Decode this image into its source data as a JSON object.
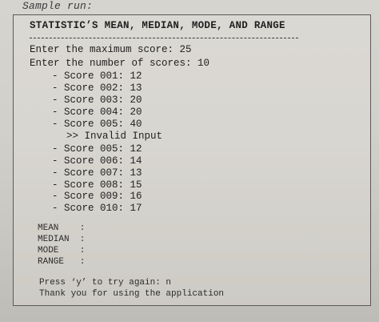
{
  "caption": "Sample run:",
  "heading": "STATISTIC’S MEAN, MEDIAN, MODE, AND RANGE",
  "prompts": [
    "Enter the maximum score: 25",
    "Enter the number of scores: 10"
  ],
  "scores_before_error": [
    "- Score 001: 12",
    "- Score 002: 13",
    "- Score 003: 20",
    "- Score 004: 20",
    "- Score 005: 40"
  ],
  "error": ">> Invalid Input",
  "scores_after_error": [
    "- Score 005: 12",
    "- Score 006: 14",
    "- Score 007: 13",
    "- Score 008: 15",
    "- Score 009: 16",
    "- Score 010: 17"
  ],
  "stats": [
    "MEAN    :",
    "MEDIAN  :",
    "MODE    :",
    "RANGE   :"
  ],
  "footer": [
    "Press ‘y’ to try again: n",
    "Thank you for using the application"
  ]
}
